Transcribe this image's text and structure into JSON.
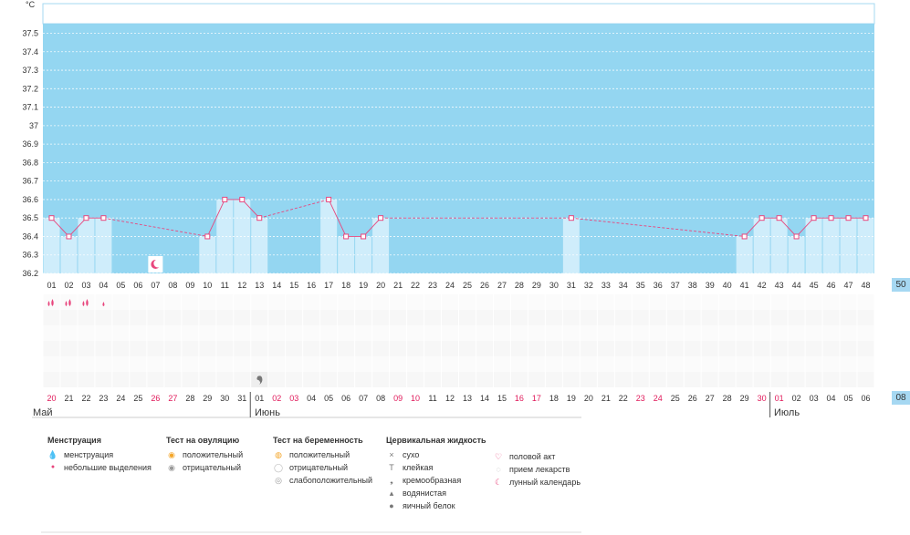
{
  "unit_label": "°C",
  "colors": {
    "plot_bg": "#94d6f1",
    "column_fill": "#cfedfb",
    "line": "#e8467d",
    "weekend_red": "#e0195a",
    "grid": "#eeeeee",
    "side_box": "#a6d8f2"
  },
  "chart_data": {
    "type": "line",
    "ylim": [
      36.2,
      37.6
    ],
    "y_ticks": [
      "37.5",
      "37.4",
      "37.3",
      "37.2",
      "37.1",
      "37",
      "36.9",
      "36.8",
      "36.7",
      "36.6",
      "36.5",
      "36.4",
      "36.3",
      "36.2"
    ],
    "cycle_days": [
      "01",
      "02",
      "03",
      "04",
      "05",
      "06",
      "07",
      "08",
      "09",
      "10",
      "11",
      "12",
      "13",
      "14",
      "15",
      "16",
      "17",
      "18",
      "19",
      "20",
      "21",
      "22",
      "23",
      "24",
      "25",
      "26",
      "27",
      "28",
      "29",
      "30",
      "31",
      "32",
      "33",
      "34",
      "35",
      "36",
      "37",
      "38",
      "39",
      "40",
      "41",
      "42",
      "43",
      "44",
      "45",
      "46",
      "47",
      "48"
    ],
    "points": [
      {
        "day": 1,
        "temp": 36.5
      },
      {
        "day": 2,
        "temp": 36.4
      },
      {
        "day": 3,
        "temp": 36.5
      },
      {
        "day": 4,
        "temp": 36.5
      },
      {
        "day": 10,
        "temp": 36.4
      },
      {
        "day": 11,
        "temp": 36.6
      },
      {
        "day": 12,
        "temp": 36.6
      },
      {
        "day": 13,
        "temp": 36.5
      },
      {
        "day": 17,
        "temp": 36.6
      },
      {
        "day": 18,
        "temp": 36.4
      },
      {
        "day": 19,
        "temp": 36.4
      },
      {
        "day": 20,
        "temp": 36.5
      },
      {
        "day": 31,
        "temp": 36.5
      },
      {
        "day": 41,
        "temp": 36.4
      },
      {
        "day": 42,
        "temp": 36.5
      },
      {
        "day": 43,
        "temp": 36.5
      },
      {
        "day": 44,
        "temp": 36.4
      },
      {
        "day": 45,
        "temp": 36.5
      },
      {
        "day": 46,
        "temp": 36.5
      },
      {
        "day": 47,
        "temp": 36.5
      },
      {
        "day": 48,
        "temp": 36.5
      }
    ]
  },
  "dates": [
    {
      "d": "20",
      "red": true
    },
    {
      "d": "21",
      "red": false
    },
    {
      "d": "22",
      "red": false
    },
    {
      "d": "23",
      "red": false
    },
    {
      "d": "24",
      "red": false
    },
    {
      "d": "25",
      "red": false
    },
    {
      "d": "26",
      "red": true
    },
    {
      "d": "27",
      "red": true
    },
    {
      "d": "28",
      "red": false
    },
    {
      "d": "29",
      "red": false
    },
    {
      "d": "30",
      "red": false
    },
    {
      "d": "31",
      "red": false
    },
    {
      "d": "01",
      "red": false
    },
    {
      "d": "02",
      "red": true
    },
    {
      "d": "03",
      "red": true
    },
    {
      "d": "04",
      "red": false
    },
    {
      "d": "05",
      "red": false
    },
    {
      "d": "06",
      "red": false
    },
    {
      "d": "07",
      "red": false
    },
    {
      "d": "08",
      "red": false
    },
    {
      "d": "09",
      "red": true
    },
    {
      "d": "10",
      "red": true
    },
    {
      "d": "11",
      "red": false
    },
    {
      "d": "12",
      "red": false
    },
    {
      "d": "13",
      "red": false
    },
    {
      "d": "14",
      "red": false
    },
    {
      "d": "15",
      "red": false
    },
    {
      "d": "16",
      "red": true
    },
    {
      "d": "17",
      "red": true
    },
    {
      "d": "18",
      "red": false
    },
    {
      "d": "19",
      "red": false
    },
    {
      "d": "20",
      "red": false
    },
    {
      "d": "21",
      "red": false
    },
    {
      "d": "22",
      "red": false
    },
    {
      "d": "23",
      "red": true
    },
    {
      "d": "24",
      "red": true
    },
    {
      "d": "25",
      "red": false
    },
    {
      "d": "26",
      "red": false
    },
    {
      "d": "27",
      "red": false
    },
    {
      "d": "28",
      "red": false
    },
    {
      "d": "29",
      "red": false
    },
    {
      "d": "30",
      "red": true
    },
    {
      "d": "01",
      "red": true
    },
    {
      "d": "02",
      "red": false
    },
    {
      "d": "03",
      "red": false
    },
    {
      "d": "04",
      "red": false
    },
    {
      "d": "05",
      "red": false
    },
    {
      "d": "06",
      "red": false
    }
  ],
  "months": {
    "may": "Май",
    "june": "Июнь",
    "july": "Июль"
  },
  "side_boxes": {
    "cycle_box": "50",
    "date_box": "08"
  },
  "menstruation_marks": [
    {
      "day": 1,
      "kind": "heavy"
    },
    {
      "day": 2,
      "kind": "heavy"
    },
    {
      "day": 3,
      "kind": "heavy"
    },
    {
      "day": 4,
      "kind": "light"
    }
  ],
  "moon_mark_day": 7,
  "cervical_mark_day": 13,
  "legend": {
    "menstruation": {
      "title": "Менструация",
      "items": [
        "менструация",
        "небольшие выделения"
      ]
    },
    "ovulation_test": {
      "title": "Тест на овуляцию",
      "items": [
        "положительный",
        "отрицательный"
      ]
    },
    "pregnancy_test": {
      "title": "Тест на беременность",
      "items": [
        "положительный",
        "отрицательный",
        "слабоположительный"
      ]
    },
    "cervical_fluid": {
      "title": "Цервикальная жидкость",
      "items": [
        "сухо",
        "клейкая",
        "кремообразная",
        "водянистая",
        "яичный белок"
      ]
    },
    "other": {
      "items": [
        "половой акт",
        "прием лекарств",
        "лунный календарь"
      ]
    }
  }
}
